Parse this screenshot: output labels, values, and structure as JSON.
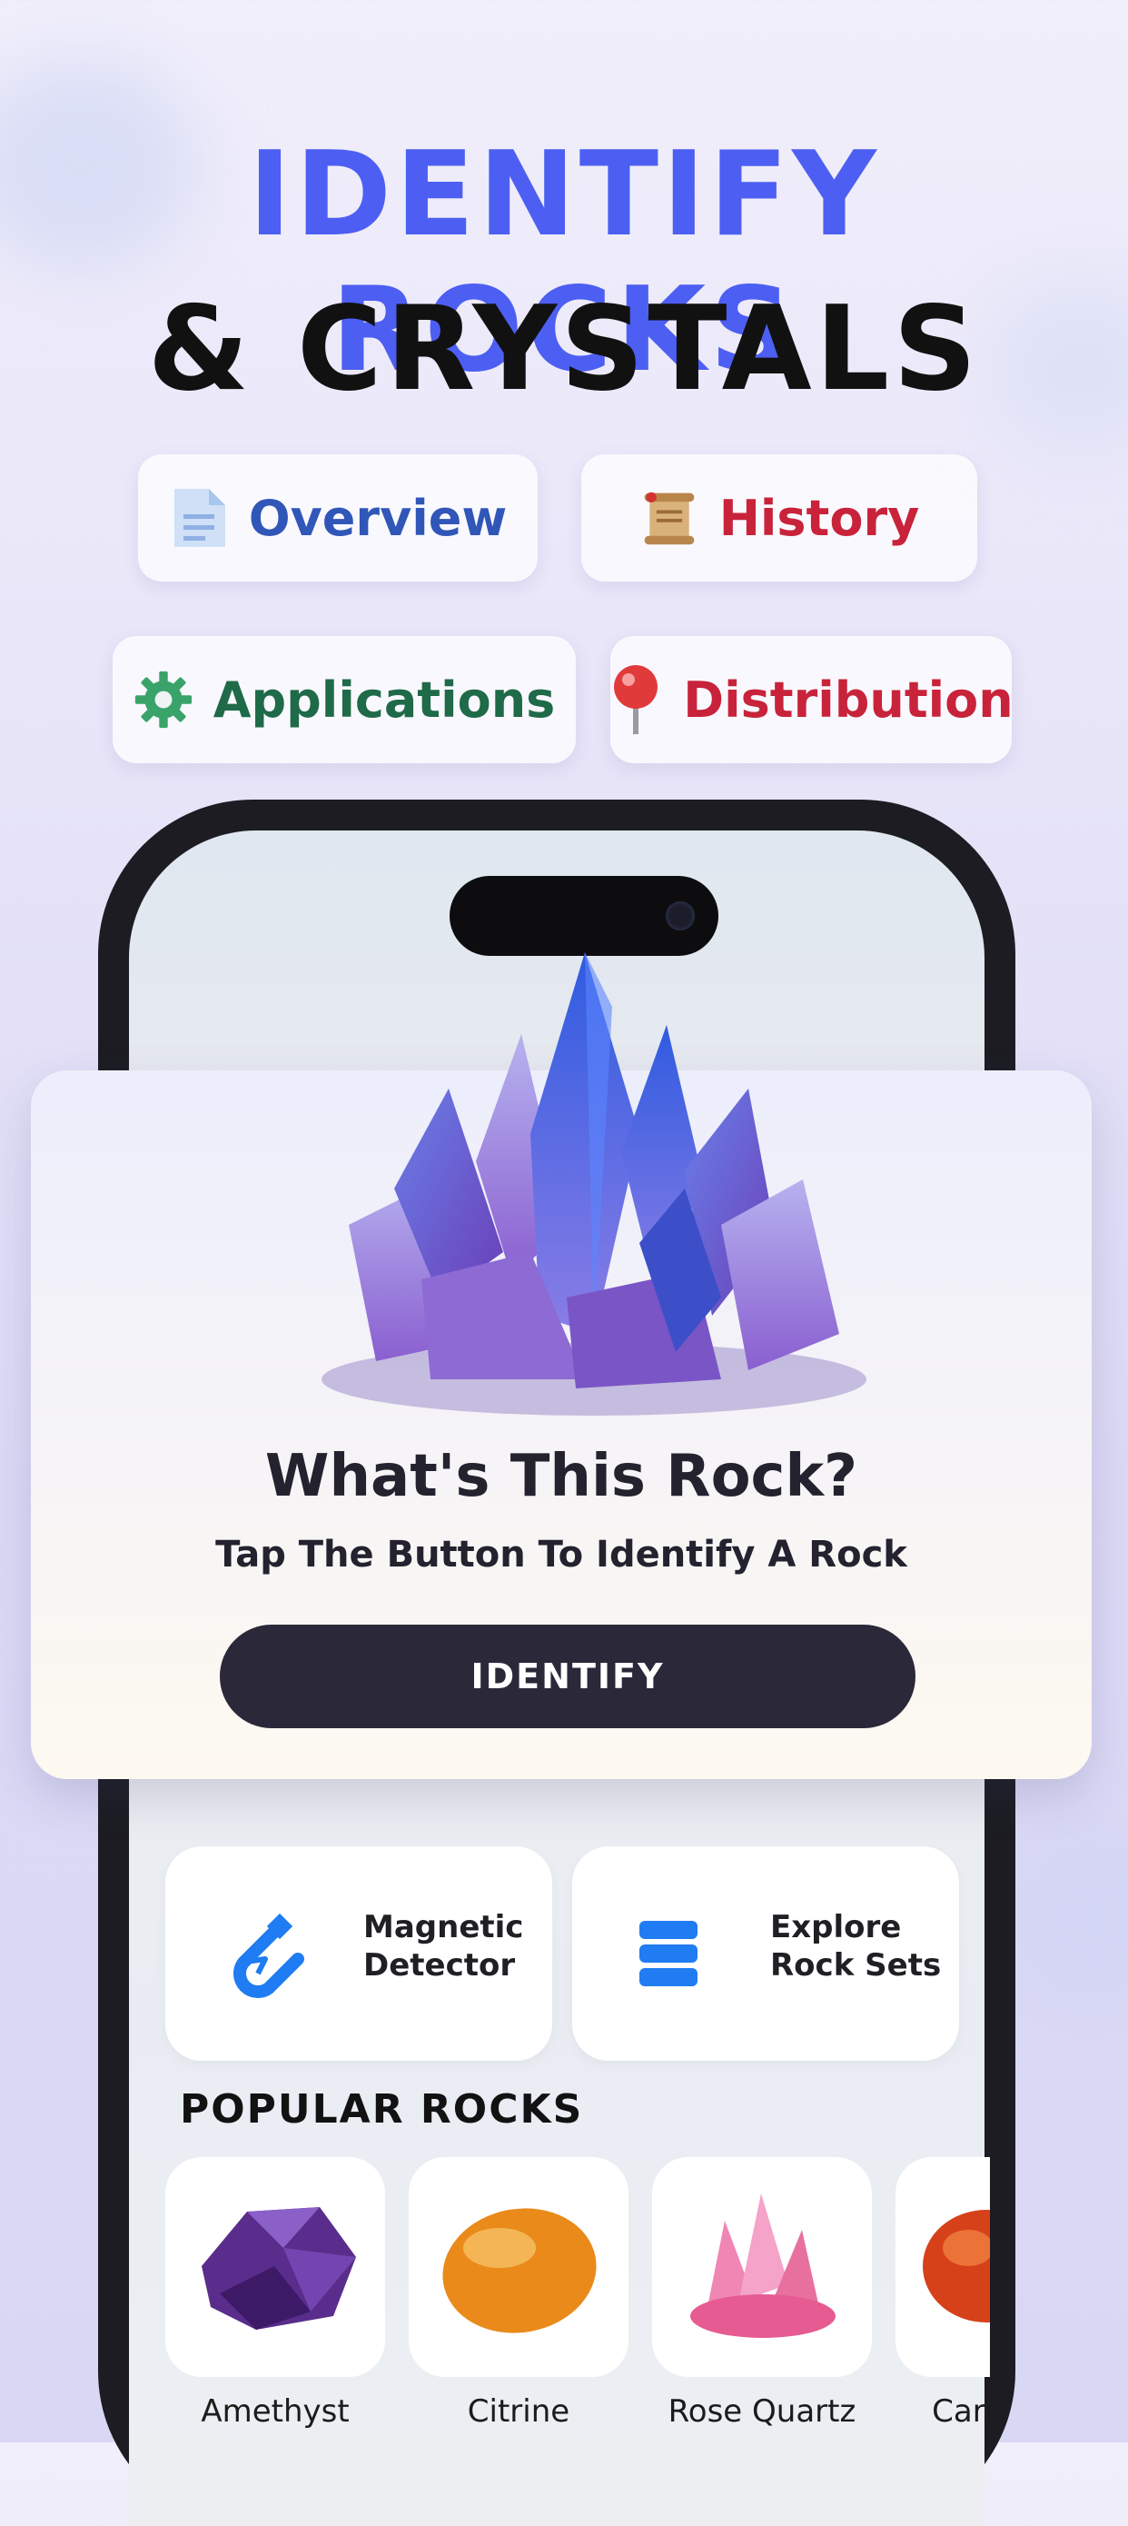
{
  "hero": {
    "line1": "IDENTIFY ROCKS",
    "line2": "& CRYSTALS"
  },
  "chips": [
    {
      "label": "Overview",
      "icon": "document-icon",
      "color": "#3056b8"
    },
    {
      "label": "History",
      "icon": "scroll-icon",
      "color": "#c8233a"
    },
    {
      "label": "Applications",
      "icon": "gear-icon",
      "color": "#1f6a48"
    },
    {
      "label": "Distribution",
      "icon": "map-pin-icon",
      "color": "#c8233a"
    }
  ],
  "identify_card": {
    "title": "What's This Rock?",
    "subtitle": "Tap The Button To Identify A Rock",
    "button_label": "IDENTIFY"
  },
  "tools": [
    {
      "label": "Magnetic Detector",
      "icon": "magnet-icon"
    },
    {
      "label": "Explore Rock Sets",
      "icon": "stack-icon"
    }
  ],
  "popular": {
    "heading": "POPULAR ROCKS",
    "items": [
      {
        "name": "Amethyst"
      },
      {
        "name": "Citrine"
      },
      {
        "name": "Rose Quartz"
      },
      {
        "name": "Carnelian"
      }
    ]
  },
  "colors": {
    "accent": "#4d5ff2",
    "button": "#2a2839",
    "tool_icon": "#1f7cf2"
  }
}
